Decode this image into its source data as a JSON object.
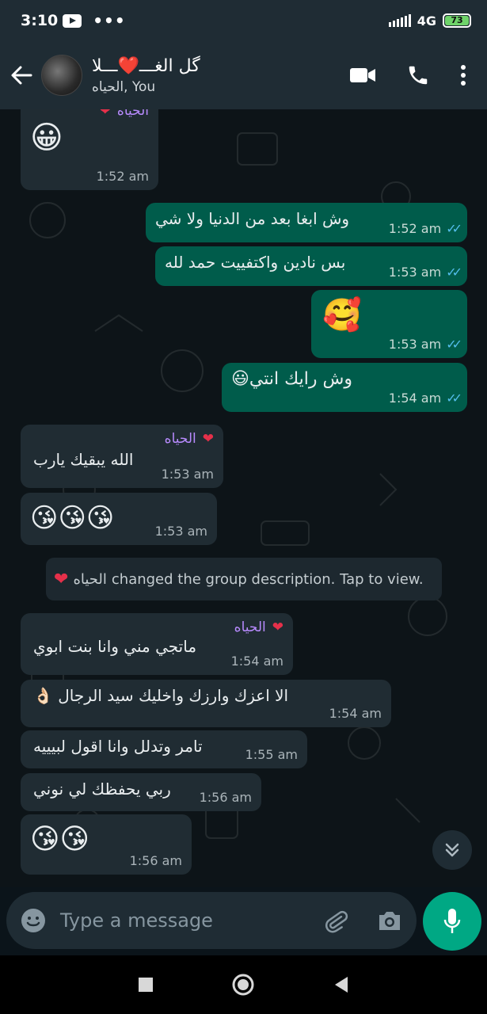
{
  "status_bar": {
    "time": "3:10",
    "network": "4G",
    "battery": "73"
  },
  "header": {
    "title": "گل الغـــ❤️ـــلا",
    "subtitle": "الحياه, You"
  },
  "messages": [
    {
      "sender": "الحياه",
      "text": "😀",
      "time": "1:52 am"
    },
    {
      "text": "وش ابغا بعد من الدنيا ولا شي",
      "time": "1:52 am"
    },
    {
      "text": "بس نادين واكتفييت حمد لله",
      "time": "1:53 am"
    },
    {
      "text": "🥰",
      "time": "1:53 am"
    },
    {
      "text": "وش رايك انتي😃",
      "time": "1:54 am"
    },
    {
      "sender": "الحياه",
      "text": "الله يبقيك يارب",
      "time": "1:53 am"
    },
    {
      "text": "😘😘😘",
      "time": "1:53 am"
    },
    {
      "sender": "الحياه",
      "text": "ماتجي مني وانا بنت ابوي",
      "time": "1:54 am"
    },
    {
      "text": "الا اعزك وارزك واخليك سيد الرجال 👌🏻",
      "time": "1:54 am"
    },
    {
      "text": "تامر وتدلل وانا اقول لبيييه",
      "time": "1:55 am"
    },
    {
      "text": "ربي يحفظك لي نوني",
      "time": "1:56 am"
    },
    {
      "text": "😘😘",
      "time": "1:56 am"
    }
  ],
  "system_message": {
    "name": "الحياه",
    "text": "changed the group description. Tap to view."
  },
  "input": {
    "placeholder": "Type a message"
  }
}
